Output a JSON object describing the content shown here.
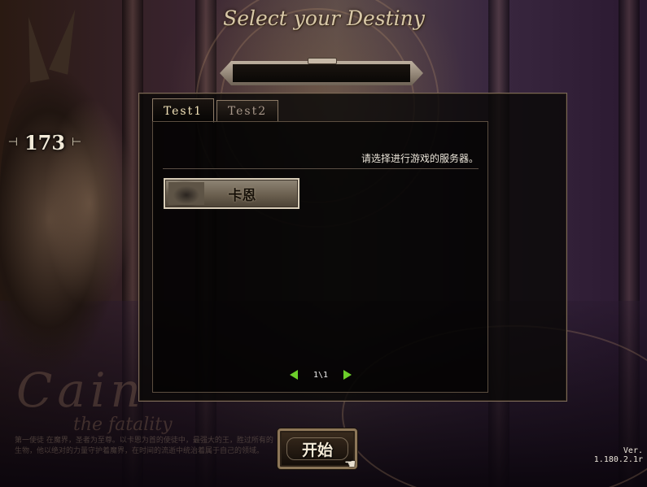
{
  "title": "Select your Destiny",
  "character": {
    "level": "173",
    "prev_arrow": "⊣",
    "next_arrow": "⊢",
    "watermark_big": "Cain",
    "watermark_small": "the fatality",
    "lore": "第一使徒\n在魔界，圣者为至尊。以卡恩为首的使徒中，最强大的王，胜过所有的生物，他以绝对的力量守护着魔界，在时间的流逝中统治着属于自己的领域。"
  },
  "name_field": {
    "value": ""
  },
  "tabs": [
    {
      "label": "Test1",
      "active": true
    },
    {
      "label": "Test2",
      "active": false
    }
  ],
  "server_panel": {
    "prompt": "请选择进行游戏的服务器。",
    "servers": [
      {
        "label": "卡恩"
      }
    ],
    "page_indicator": "1\\1"
  },
  "start_button": {
    "label": "开始"
  },
  "version": "Ver. 1.180.2.1r",
  "colors": {
    "pager_arrow": "#6ccf2a",
    "panel_border": "#7c6a58",
    "title_text": "#d8c8a8"
  },
  "icons": {
    "pager_prev": "triangle-left-icon",
    "pager_next": "triangle-right-icon",
    "cursor": "pointer-hand-icon"
  }
}
